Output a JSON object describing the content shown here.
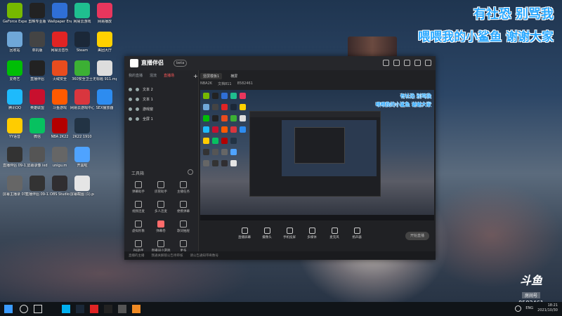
{
  "desktop": {
    "icons": [
      {
        "label": "GeForce Experience",
        "color": "#76b900"
      },
      {
        "label": "剪映专业版",
        "color": "#222222"
      },
      {
        "label": "Wallpaper Engine",
        "color": "#2f6fd6"
      },
      {
        "label": "网易云游戏",
        "color": "#1fbf8f"
      },
      {
        "label": "网易播放",
        "color": "#e8365d"
      },
      {
        "label": "回收站",
        "color": "#6fa7d8"
      },
      {
        "label": "单机版",
        "color": "#444444"
      },
      {
        "label": "网易云音乐",
        "color": "#e02424"
      },
      {
        "label": "Steam",
        "color": "#1b2838"
      },
      {
        "label": "美团大厅",
        "color": "#ffd100"
      },
      {
        "label": "爱奇艺",
        "color": "#00be06"
      },
      {
        "label": "直播伴侣",
        "color": "#222222"
      },
      {
        "label": "火绒安全",
        "color": "#e84c1e"
      },
      {
        "label": "360安全卫士",
        "color": "#3cb034"
      },
      {
        "label": "无标题 911.mp4",
        "color": "#dddddd"
      },
      {
        "label": "腾讯QQ",
        "color": "#1ebafc"
      },
      {
        "label": "英雄联盟",
        "color": "#c8102e"
      },
      {
        "label": "斗鱼游戏",
        "color": "#ff5a00"
      },
      {
        "label": "网易云游戏中心",
        "color": "#d9363e"
      },
      {
        "label": "SEX播放器",
        "color": "#2d8cf0"
      },
      {
        "label": "YY语音",
        "color": "#ffcc00"
      },
      {
        "label": "微信",
        "color": "#07c160"
      },
      {
        "label": "NBA 2K22",
        "color": "#b30000"
      },
      {
        "label": "2K22 1910",
        "color": "#223344"
      },
      {
        "label": "",
        "color": "#000000"
      },
      {
        "label": "直播伴侣 09-13 sp",
        "color": "#333333"
      },
      {
        "label": "屏幕录像 ixd",
        "color": "#555555"
      },
      {
        "label": "unigu.m",
        "color": "#666666"
      },
      {
        "label": "开黑啦",
        "color": "#4fa3ff"
      },
      {
        "label": "",
        "color": "#000000"
      },
      {
        "label": "屏幕主播录 0701.avi",
        "color": "#666666"
      },
      {
        "label": "直播伴侣 09-13 sp",
        "color": "#333333"
      },
      {
        "label": "OBS Studio",
        "color": "#302e31"
      },
      {
        "label": "屏幕截图 (1).pdf",
        "color": "#e5e5e5"
      }
    ]
  },
  "banner": {
    "line1": "有社恐 别骂我",
    "line2": "喂喂我的小鲨鱼 谢谢大家"
  },
  "app": {
    "name": "直播伴侣",
    "version": "beta",
    "tabs": [
      "我的直播",
      "混流",
      "直播场"
    ],
    "scenes": [
      "文本 2",
      "文本 1",
      "游戏窗",
      "全屏 1"
    ],
    "toolbox_title": "工具箱",
    "tools": [
      "弹幕助手",
      "房管助手",
      "主播任务",
      "视频连麦",
      "多人连麦",
      "便携弹幕",
      "虚拟形象",
      "弹幕卷",
      "歌词抽屉",
      "PK助手",
      "直播间小游戏",
      "更多"
    ],
    "preview_tabs": [
      "竖屏模板1",
      "横屏"
    ],
    "preview_info": [
      "NBA2K",
      "文档811",
      "8582461"
    ],
    "inner_banner": {
      "line1": "有社恐 别骂我",
      "line2": "喂喂我的小鲨鱼 谢谢大家"
    },
    "controls": [
      "直播屏幕",
      "摄像头",
      "手机投屏",
      "多媒体",
      "麦克风",
      "扬声器"
    ],
    "live_button": "开始直播",
    "status": [
      "直播的主播",
      "我通关解锁公告待审核",
      "请公告通知带奇数号"
    ]
  },
  "watermark": {
    "brand": "斗鱼",
    "room_label": "房间号",
    "room_number": "8582461"
  },
  "taskbar": {
    "lang": "ENG",
    "time": "18:21",
    "date": "2021/10/30"
  }
}
